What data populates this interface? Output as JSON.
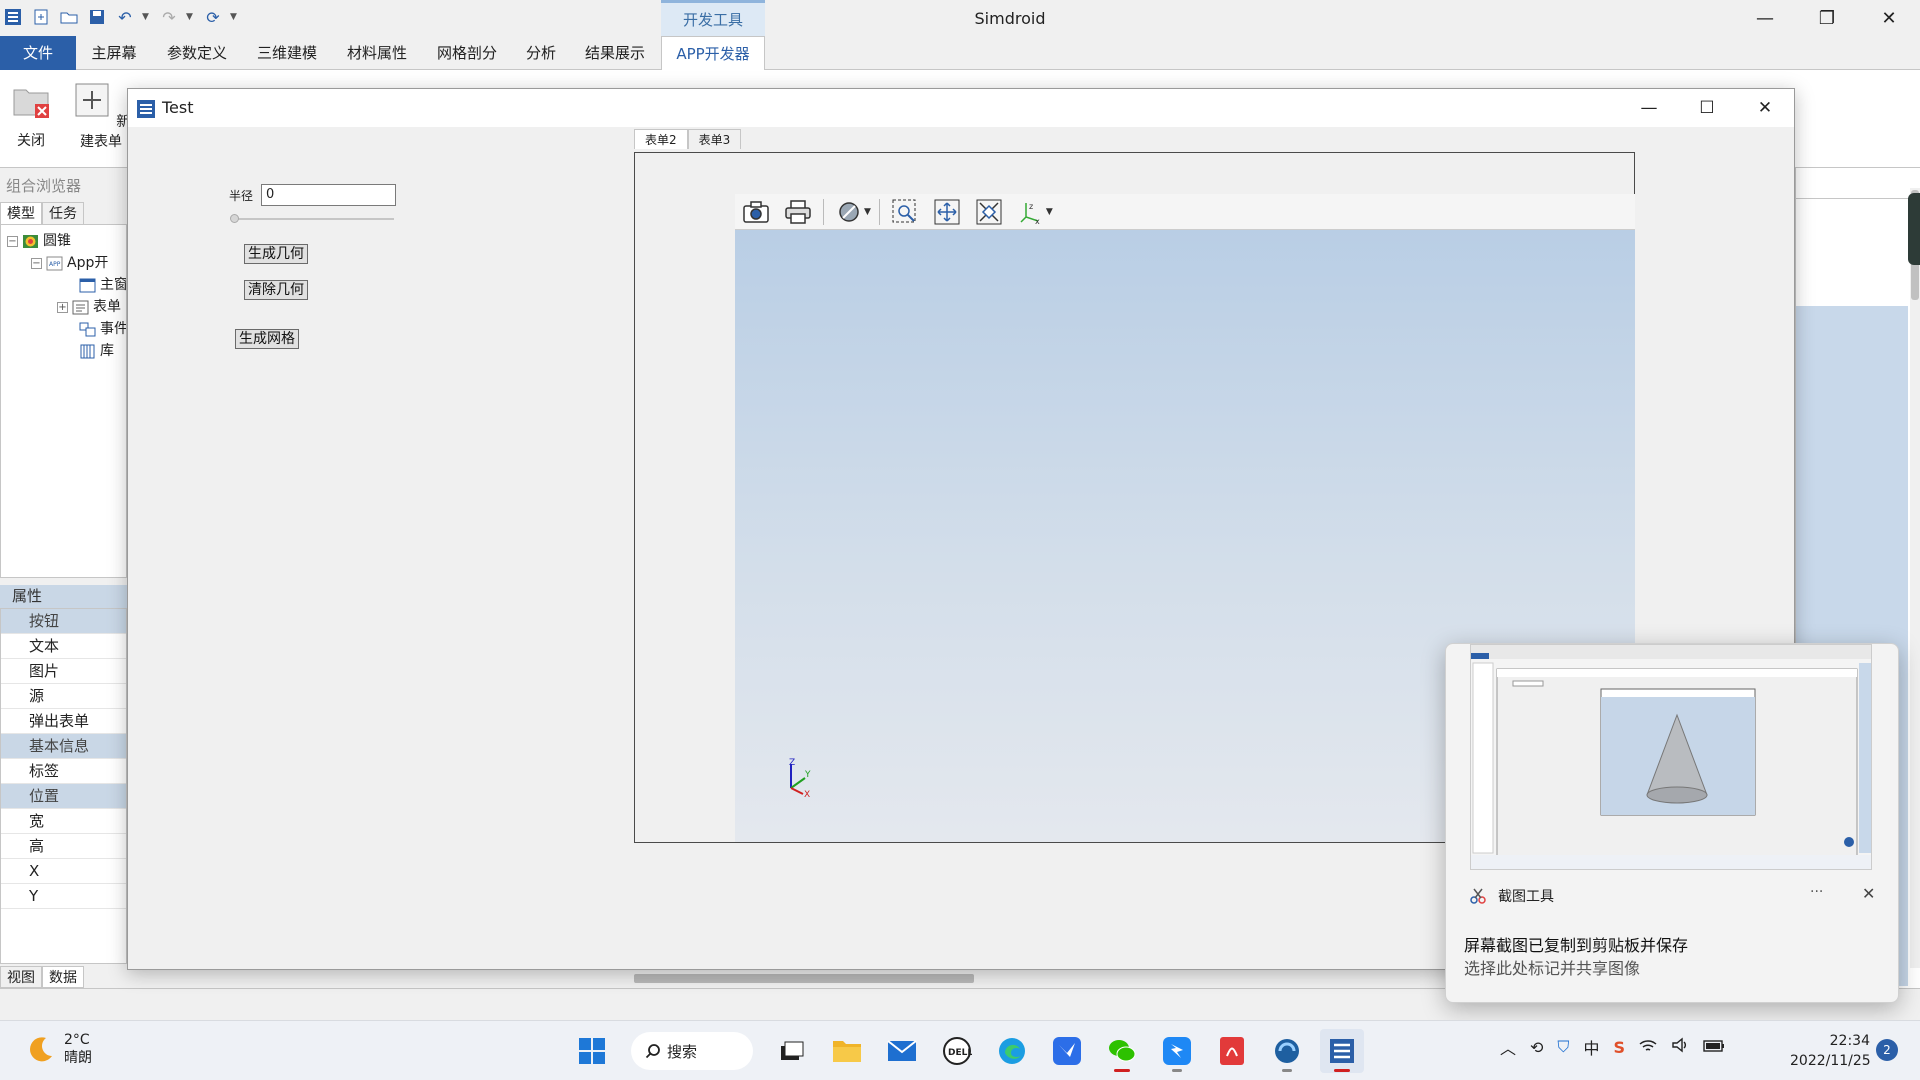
{
  "app": {
    "title": "Simdroid",
    "contextual_tab": "开发工具",
    "window_controls": [
      "minimize",
      "restore",
      "close"
    ]
  },
  "ribbon": {
    "tabs": [
      {
        "label": "文件",
        "kind": "file"
      },
      {
        "label": "主屏幕"
      },
      {
        "label": "参数定义"
      },
      {
        "label": "三维建模"
      },
      {
        "label": "材料属性"
      },
      {
        "label": "网格剖分"
      },
      {
        "label": "分析"
      },
      {
        "label": "结果展示"
      },
      {
        "label": "APP开发器",
        "active": true
      }
    ],
    "buttons": {
      "close": "关闭",
      "new_form": "新建表单"
    }
  },
  "left_panel": {
    "browser_title": "组合浏览器",
    "tabs": [
      "模型",
      "任务"
    ],
    "tree": {
      "root": "圆锥",
      "app": "App开",
      "children": [
        "主窗",
        "表单",
        "事件",
        "库"
      ]
    },
    "props_title": "属性",
    "props": [
      {
        "label": "按钮",
        "category": true
      },
      {
        "label": "文本"
      },
      {
        "label": "图片"
      },
      {
        "label": "源"
      },
      {
        "label": "弹出表单"
      },
      {
        "label": "基本信息",
        "category": true
      },
      {
        "label": "标签"
      },
      {
        "label": "位置",
        "category": true
      },
      {
        "label": "宽"
      },
      {
        "label": "高"
      },
      {
        "label": "X"
      },
      {
        "label": "Y"
      }
    ],
    "bottom_tabs": [
      "视图",
      "数据"
    ]
  },
  "dialog": {
    "title": "Test",
    "radius_label": "半径",
    "radius_value": "0",
    "radius_slider_fraction": 0,
    "btn_generate_geometry": "生成几何",
    "btn_clear_geometry": "清除几何",
    "btn_generate_mesh": "生成网格",
    "form_tabs": [
      "表单2",
      "表单3"
    ],
    "viewer_toolbar": [
      "camera-icon",
      "print-icon",
      "no-symbol-icon",
      "zoom-box-icon",
      "pan-icon",
      "fit-all-icon",
      "axes-icon"
    ],
    "triad_labels": {
      "z": "Z",
      "y": "Y",
      "x": "X"
    }
  },
  "notification": {
    "app": "截图工具",
    "more": "···",
    "title": "屏幕截图已复制到剪贴板并保存",
    "subtitle": "选择此处标记并共享图像"
  },
  "taskbar": {
    "weather_temp": "2°C",
    "weather_desc": "晴朗",
    "search_label": "搜索",
    "time": "22:34",
    "date": "2022/11/25",
    "notification_count": "2",
    "input_mode": "中"
  },
  "colors": {
    "accent": "#2b5fa8",
    "viewport_top": "#b9cee5",
    "viewport_bottom": "#e4e8ee"
  }
}
